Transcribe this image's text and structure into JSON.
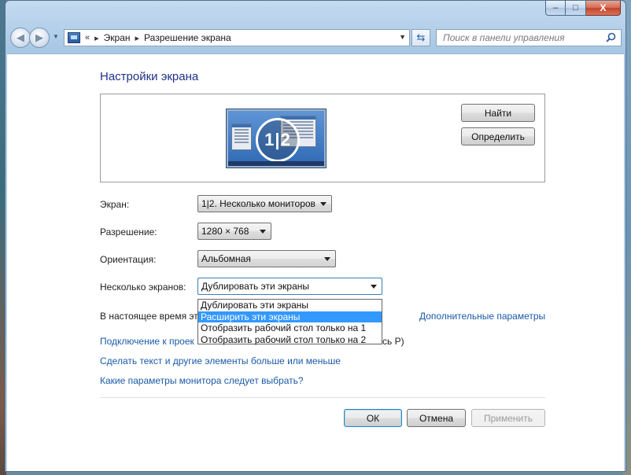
{
  "window": {
    "caption": {
      "minimize": "–",
      "maximize": "□",
      "close": "X"
    }
  },
  "navbar": {
    "breadcrumb_sep_start": "«",
    "breadcrumbs": [
      "Экран",
      "Разрешение экрана"
    ],
    "breadcrumb_arrow": "▸",
    "search_placeholder": "Поиск в панели управления"
  },
  "page": {
    "title": "Настройки экрана",
    "find_button": "Найти",
    "identify_button": "Определить",
    "monitor_label": "1|2"
  },
  "form": {
    "display_label": "Экран:",
    "display_value": "1|2. Несколько мониторов",
    "resolution_label": "Разрешение:",
    "resolution_value": "1280 × 768",
    "orientation_label": "Ориентация:",
    "orientation_value": "Альбомная",
    "multiple_label": "Несколько экранов:",
    "multiple_value": "Дублировать эти экраны",
    "multiple_options": [
      "Дублировать эти экраны",
      "Расширить эти экраны",
      "Отобразить рабочий стол только на 1",
      "Отобразить рабочий стол только на 2"
    ],
    "multiple_highlighted_index": 1
  },
  "info": {
    "current_primary_partial": "В настоящее время эт",
    "advanced_link": "Дополнительные параметры",
    "projector_link_partial": "Подключение к проек",
    "projector_suffix_partial": "сь P)",
    "text_size_link": "Сделать текст и другие элементы больше или меньше",
    "which_settings_link": "Какие параметры монитора следует выбрать?"
  },
  "footer": {
    "ok": "ОК",
    "cancel": "Отмена",
    "apply": "Применить"
  },
  "colors": {
    "title": "#1e3287",
    "link": "#1a5aa6",
    "highlight": "#3399ff"
  }
}
